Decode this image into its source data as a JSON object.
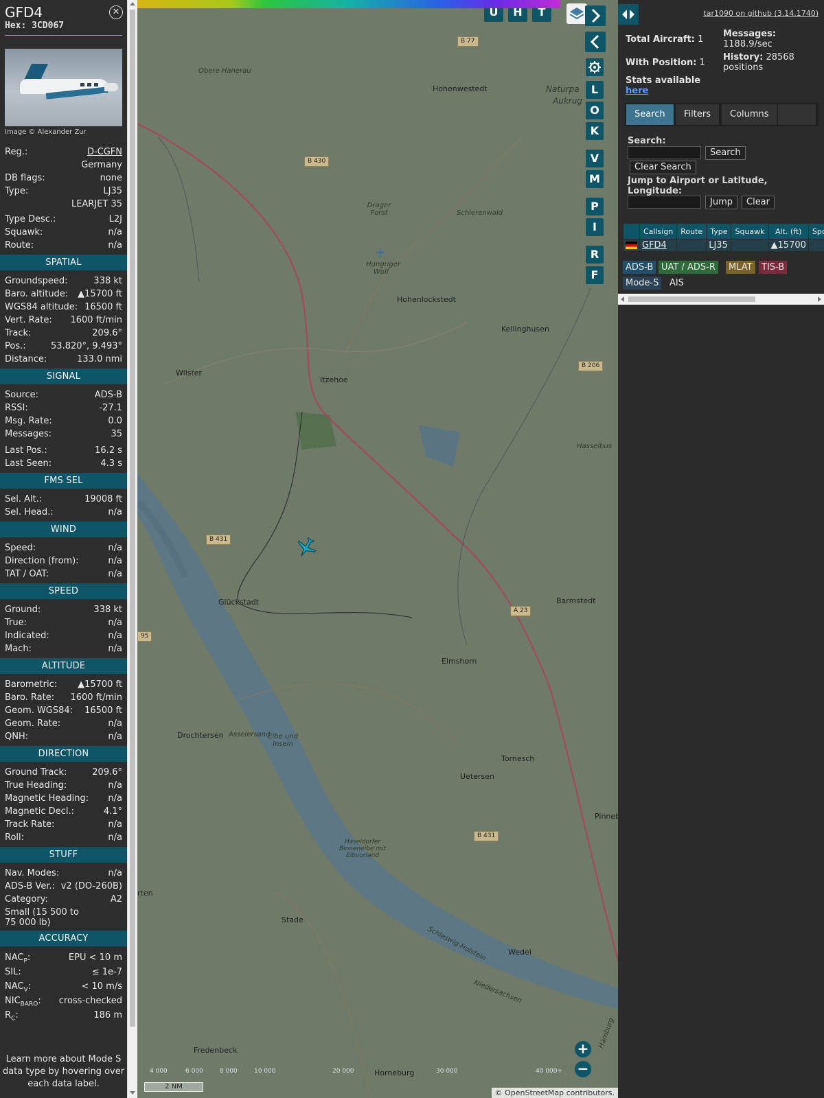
{
  "sidebar": {
    "callsign": "GFD4",
    "hex_label": "Hex:",
    "hex": "3CD067",
    "close_glyph": "✕",
    "photo_credit": "Image © Alexander Zur",
    "reg_label": "Reg.:",
    "reg": "D-CGFN",
    "country": "Germany",
    "dbflags_label": "DB flags:",
    "dbflags": "none",
    "type_label": "Type:",
    "type": "LJ35",
    "type_full": "LEARJET 35",
    "typedesc_label": "Type Desc.:",
    "typedesc": "L2J",
    "squawk_label": "Squawk:",
    "squawk": "n/a",
    "route_label": "Route:",
    "route": "n/a",
    "spatial": {
      "title": "SPATIAL",
      "rows": [
        {
          "label": "Groundspeed:",
          "value": "338 kt"
        },
        {
          "label": "Baro. altitude:",
          "value": "▲15700 ft"
        },
        {
          "label": "WGS84 altitude:",
          "value": "16500 ft"
        },
        {
          "label": "Vert. Rate:",
          "value": "1600 ft/min"
        },
        {
          "label": "Track:",
          "value": "209.6°"
        },
        {
          "label": "Pos.:",
          "value": "53.820°, 9.493°"
        },
        {
          "label": "Distance:",
          "value": "133.0 nmi"
        }
      ]
    },
    "signal": {
      "title": "SIGNAL",
      "rows": [
        {
          "label": "Source:",
          "value": "ADS-B"
        },
        {
          "label": "RSSI:",
          "value": "-27.1"
        },
        {
          "label": "Msg. Rate:",
          "value": "0.0"
        },
        {
          "label": "Messages:",
          "value": "35"
        },
        {
          "label": "Last Pos.:",
          "value": "16.2 s"
        },
        {
          "label": "Last Seen:",
          "value": "4.3 s"
        }
      ]
    },
    "fms": {
      "title": "FMS SEL",
      "rows": [
        {
          "label": "Sel. Alt.:",
          "value": "19008 ft"
        },
        {
          "label": "Sel. Head.:",
          "value": "n/a"
        }
      ]
    },
    "wind": {
      "title": "WIND",
      "rows": [
        {
          "label": "Speed:",
          "value": "n/a"
        },
        {
          "label": "Direction (from):",
          "value": "n/a"
        },
        {
          "label": "TAT / OAT:",
          "value": "n/a"
        }
      ]
    },
    "speed": {
      "title": "SPEED",
      "rows": [
        {
          "label": "Ground:",
          "value": "338 kt"
        },
        {
          "label": "True:",
          "value": "n/a"
        },
        {
          "label": "Indicated:",
          "value": "n/a"
        },
        {
          "label": "Mach:",
          "value": "n/a"
        }
      ]
    },
    "altitude": {
      "title": "ALTITUDE",
      "rows": [
        {
          "label": "Barometric:",
          "value": "▲15700 ft"
        },
        {
          "label": "Baro. Rate:",
          "value": "1600 ft/min"
        },
        {
          "label": "Geom. WGS84:",
          "value": "16500 ft"
        },
        {
          "label": "Geom. Rate:",
          "value": "n/a"
        },
        {
          "label": "QNH:",
          "value": "n/a"
        }
      ]
    },
    "direction": {
      "title": "DIRECTION",
      "rows": [
        {
          "label": "Ground Track:",
          "value": "209.6°"
        },
        {
          "label": "True Heading:",
          "value": "n/a"
        },
        {
          "label": "Magnetic Heading:",
          "value": "n/a"
        },
        {
          "label": "Magnetic Decl.:",
          "value": "4.1°"
        },
        {
          "label": "Track Rate:",
          "value": "n/a"
        },
        {
          "label": "Roll:",
          "value": "n/a"
        }
      ]
    },
    "stuff": {
      "title": "STUFF",
      "rows": [
        {
          "label": "Nav. Modes:",
          "value": "n/a"
        },
        {
          "label": "ADS-B Ver.:",
          "value": "v2 (DO-260B)"
        },
        {
          "label": "Category:",
          "value": "A2"
        }
      ],
      "category_desc": "Small (15 500 to 75 000 lb)"
    },
    "accuracy": {
      "title": "ACCURACY",
      "nacp_main": "NAC",
      "nacp_sub": "P",
      "nacp": "EPU < 10 m",
      "sil_label": "SIL:",
      "sil": "≤ 1e-7",
      "nacv_main": "NAC",
      "nacv_sub": "V",
      "nacv": "< 10 m/s",
      "nicbaro_main": "NIC",
      "nicbaro_sub": "BARO",
      "nicbaro": "cross-checked",
      "rc_main": "R",
      "rc_sub": "C",
      "rc": "186 m"
    },
    "learn_more": "Learn more about Mode S data type by hovering over each data label."
  },
  "map": {
    "buttons": [
      "U",
      "H",
      "T"
    ],
    "side_buttons": [
      "L",
      "O",
      "K",
      "V",
      "M",
      "P",
      "I",
      "R",
      "F"
    ],
    "places": [
      {
        "name": "Hohenwestedt"
      },
      {
        "name": "Naturpa"
      },
      {
        "name": "Aukrug"
      },
      {
        "name": "Obere Hanerau"
      },
      {
        "name": "Drager Forst"
      },
      {
        "name": "Schierenwald"
      },
      {
        "name": "Hungriger Wolf"
      },
      {
        "name": "Hohenlockstedt"
      },
      {
        "name": "Kellinghusen"
      },
      {
        "name": "Wilster"
      },
      {
        "name": "Itzehoe"
      },
      {
        "name": "Hasselbus"
      },
      {
        "name": "Glückstadt"
      },
      {
        "name": "Barmstedt"
      },
      {
        "name": "Elmshorn"
      },
      {
        "name": "Drochtersen"
      },
      {
        "name": "Asselersand"
      },
      {
        "name": "Elbe und Inseln"
      },
      {
        "name": "Tornesch"
      },
      {
        "name": "Uetersen"
      },
      {
        "name": "Pinneb"
      },
      {
        "name": "Haseldorfer Binnenelbe mit Elbvorland"
      },
      {
        "name": "rten"
      },
      {
        "name": "Stade"
      },
      {
        "name": "Wedel"
      },
      {
        "name": "Schleswig-Holstein"
      },
      {
        "name": "Niedersachsen"
      },
      {
        "name": "Hamburg"
      },
      {
        "name": "Fredenbeck"
      },
      {
        "name": "Horneburg"
      }
    ],
    "roads": [
      "B 77",
      "B 430",
      "B 206",
      "B 431",
      "A 23",
      "B 431",
      "95"
    ],
    "colorbar_ticks": [
      "4 000",
      "6 000",
      "8 000",
      "10 000",
      "20 000",
      "30 000",
      "40 000+"
    ],
    "scale": "2 NM",
    "attribution_prefix": "© ",
    "attribution_link": "OpenStreetMap",
    "attribution_suffix": " contributors.",
    "zoom_in": "+",
    "zoom_out": "−"
  },
  "panel": {
    "github": "tar1090 on github (3.14.1740)",
    "total_aircraft": "Total Aircraft:",
    "total_aircraft_val": "1",
    "with_position": "With Position:",
    "with_position_val": "1",
    "messages_label": "Messages:",
    "messages_val": "1188.9/sec",
    "history_label": "History:",
    "history_val": "28568 positions",
    "stats_text": "Stats available",
    "stats_link": "here",
    "tabs": [
      "Search",
      "Filters",
      "Columns"
    ],
    "search_label": "Search:",
    "search_btn": "Search",
    "clear_search_btn": "Clear Search",
    "jump_label": "Jump to Airport or Latitude, Longitude:",
    "jump_btn": "Jump",
    "clear_btn": "Clear",
    "table_headers": [
      "",
      "Callsign",
      "Route",
      "Type",
      "Squawk",
      "Alt. (ft)",
      "Spd"
    ],
    "table_rows": [
      {
        "callsign": "GFD4",
        "route": "",
        "type": "LJ35",
        "squawk": "",
        "alt": "▲15700",
        "spd": ""
      }
    ],
    "sources": [
      {
        "label": "ADS-B",
        "color": "#1f4f6b"
      },
      {
        "label": "UAT / ADS-R",
        "color": "#2f6b3a"
      },
      {
        "label": "MLAT",
        "color": "#7a6328"
      },
      {
        "label": "TIS-B",
        "color": "#7a2b3c"
      },
      {
        "label": "Mode-S",
        "color": "#2a4157"
      },
      {
        "label": "AIS",
        "color": "#2b2b2b"
      }
    ]
  }
}
